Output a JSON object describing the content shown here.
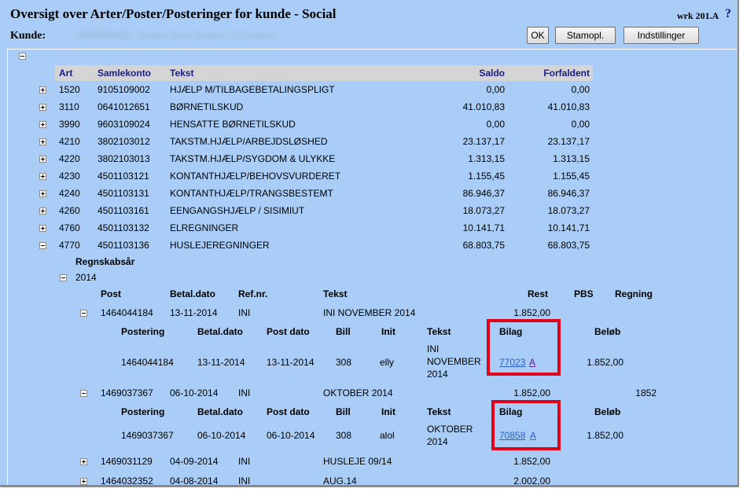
{
  "window": {
    "title": "Oversigt over Arter/Poster/Posteringer for kunde - Social",
    "code": "wrk 201.A",
    "help": "?"
  },
  "kunde": {
    "label": "Kunde:",
    "value": "0000000000 - Xxxxxx Xxxx Xxxxxx / XXXxxxxx"
  },
  "buttons": {
    "ok": "OK",
    "stamopl": "Stamopl.",
    "indstillinger": "Indstillinger"
  },
  "table": {
    "headers": {
      "art": "Art",
      "samlekonto": "Samlekonto",
      "tekst": "Tekst",
      "saldo": "Saldo",
      "forfaldent": "Forfaldent"
    },
    "rows": [
      {
        "art": "1520",
        "samlekonto": "9105109002",
        "tekst": "HJÆLP M/TILBAGEBETALINGSPLIGT",
        "saldo": "0,00",
        "forfaldent": "0,00"
      },
      {
        "art": "3110",
        "samlekonto": "0641012651",
        "tekst": "BØRNETILSKUD",
        "saldo": "41.010,83",
        "forfaldent": "41.010,83"
      },
      {
        "art": "3990",
        "samlekonto": "9603109024",
        "tekst": "HENSATTE BØRNETILSKUD",
        "saldo": "0,00",
        "forfaldent": "0,00"
      },
      {
        "art": "4210",
        "samlekonto": "3802103012",
        "tekst": "TAKSTM.HJÆLP/ARBEJDSLØSHED",
        "saldo": "23.137,17",
        "forfaldent": "23.137,17"
      },
      {
        "art": "4220",
        "samlekonto": "3802103013",
        "tekst": "TAKSTM.HJÆLP/SYGDOM & ULYKKE",
        "saldo": "1.313,15",
        "forfaldent": "1.313,15"
      },
      {
        "art": "4230",
        "samlekonto": "4501103121",
        "tekst": "KONTANTHJÆLP/BEHOVSVURDERET",
        "saldo": "1.155,45",
        "forfaldent": "1.155,45"
      },
      {
        "art": "4240",
        "samlekonto": "4501103131",
        "tekst": "KONTANTHJÆLP/TRANGSBESTEMT",
        "saldo": "86.946,37",
        "forfaldent": "86.946,37"
      },
      {
        "art": "4260",
        "samlekonto": "4501103161",
        "tekst": "EENGANGSHJÆLP / SISIMIUT",
        "saldo": "18.073,27",
        "forfaldent": "18.073,27"
      },
      {
        "art": "4760",
        "samlekonto": "4501103132",
        "tekst": "ELREGNINGER",
        "saldo": "10.141,71",
        "forfaldent": "10.141,71"
      },
      {
        "art": "4770",
        "samlekonto": "4501103136",
        "tekst": "HUSLEJEREGNINGER",
        "saldo": "68.803,75",
        "forfaldent": "68.803,75"
      }
    ]
  },
  "regnskabsaar": {
    "label": "Regnskabsår",
    "year": "2014"
  },
  "post_headers": {
    "post": "Post",
    "betal_dato": "Betal.dato",
    "ref_nr": "Ref.nr.",
    "tekst": "Tekst",
    "rest": "Rest",
    "pbs": "PBS",
    "regning": "Regning"
  },
  "postering_headers": {
    "postering": "Postering",
    "betal_dato": "Betal.dato",
    "post_dato": "Post dato",
    "bill": "Bill",
    "init": "Init",
    "tekst": "Tekst",
    "bilag": "Bilag",
    "beloeb": "Beløb"
  },
  "posts": [
    {
      "post": "1464044184",
      "betal_dato": "13-11-2014",
      "ref_nr": "INI",
      "tekst": "INI NOVEMBER 2014",
      "rest": "1.852,00",
      "regning": "",
      "postering": {
        "postering": "1464044184",
        "betal_dato": "13-11-2014",
        "post_dato": "13-11-2014",
        "bill": "308",
        "init": "elly",
        "tekst_lines": [
          "INI",
          "NOVEMBER",
          "2014"
        ],
        "bilag": "77023",
        "bilag_a": "A",
        "beloeb": "1.852,00"
      }
    },
    {
      "post": "1469037367",
      "betal_dato": "06-10-2014",
      "ref_nr": "INI",
      "tekst": "OKTOBER 2014",
      "rest": "1.852,00",
      "regning": "1852",
      "postering": {
        "postering": "1469037367",
        "betal_dato": "06-10-2014",
        "post_dato": "06-10-2014",
        "bill": "308",
        "init": "alol",
        "tekst_lines": [
          "OKTOBER",
          "2014"
        ],
        "bilag": "70858",
        "bilag_a": "A",
        "beloeb": "1.852,00"
      }
    },
    {
      "post": "1469031129",
      "betal_dato": "04-09-2014",
      "ref_nr": "INI",
      "tekst": "HUSLEJE 09/14",
      "rest": "1.852,00"
    },
    {
      "post": "1464032352",
      "betal_dato": "04-08-2014",
      "ref_nr": "INI",
      "tekst": "AUG.14",
      "rest": "2.002,00"
    }
  ],
  "colors": {
    "background": "#a9cdf6",
    "header_bar": "#d4d4d4",
    "header_text": "#1a1a8c",
    "highlight": "#e0001a",
    "link": "#2a5fc7"
  }
}
